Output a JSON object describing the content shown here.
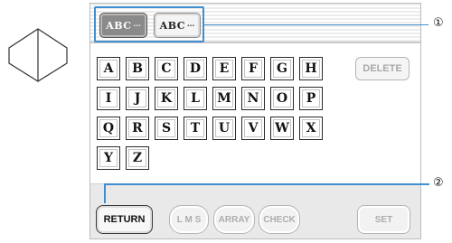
{
  "font_buttons": [
    {
      "label": "ABC",
      "dots": "···",
      "selected": true
    },
    {
      "label": "ABC",
      "dots": "···",
      "selected": false
    }
  ],
  "characters": [
    "A",
    "B",
    "C",
    "D",
    "E",
    "F",
    "G",
    "H",
    "I",
    "J",
    "K",
    "L",
    "M",
    "N",
    "O",
    "P",
    "Q",
    "R",
    "S",
    "T",
    "U",
    "V",
    "W",
    "X",
    "Y",
    "Z"
  ],
  "delete_label": "DELETE",
  "bottom_buttons": {
    "return": "RETURN",
    "lms": "L M S",
    "array": "ARRAY",
    "check": "CHECK",
    "set": "SET"
  },
  "callouts": {
    "one": "①",
    "two": "②"
  },
  "colors": {
    "accent": "#3f8fd0",
    "disabled_text": "#adadad"
  }
}
